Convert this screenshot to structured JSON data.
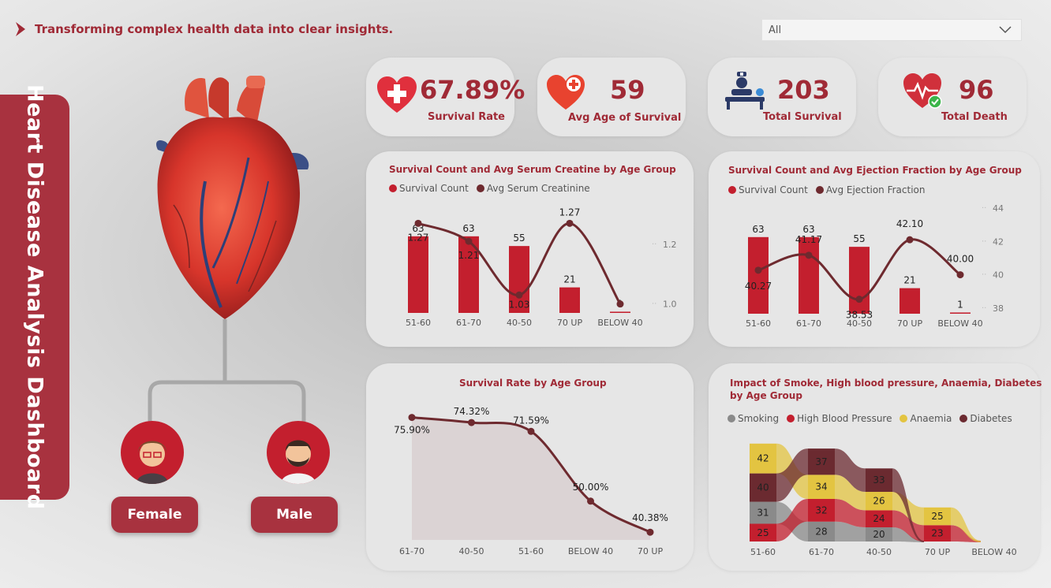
{
  "header": {
    "tagline": "Transforming complex health data into clear insights."
  },
  "filter": {
    "value": "All"
  },
  "sidebar": {
    "title": "Heart Disease Analysis Dashboard"
  },
  "gender": {
    "female": "Female",
    "male": "Male"
  },
  "kpis": [
    {
      "value": "67.89%",
      "label": "Survival Rate",
      "icon": "heart-plus-icon"
    },
    {
      "value": "59",
      "label": "Avg Age of Survival",
      "icon": "heart-medical-icon"
    },
    {
      "value": "203",
      "label": "Total Survival",
      "icon": "patient-bed-icon"
    },
    {
      "value": "96",
      "label": "Total Death",
      "icon": "heart-pulse-icon"
    }
  ],
  "colors": {
    "accent": "#a02a36",
    "bar": "#c31f2e",
    "line": "#6e2a2f",
    "smoking": "#8a8a8a",
    "hbp": "#c31f2e",
    "anaemia": "#e3c441",
    "diabetes": "#6b2a30"
  },
  "chart_data": [
    {
      "type": "bar",
      "title": "Survival Count and Avg Serum Creatine by Age Group",
      "categories": [
        "51-60",
        "61-70",
        "40-50",
        "70 UP",
        "BELOW 40"
      ],
      "series": [
        {
          "name": "Survival Count",
          "kind": "bar",
          "values": [
            63,
            63,
            55,
            21,
            1
          ]
        },
        {
          "name": "Avg Serum Creatinine",
          "kind": "line",
          "values": [
            1.27,
            1.21,
            1.03,
            1.27,
            1.0
          ]
        }
      ],
      "y2_ticks": [
        "1.2",
        "1.0"
      ]
    },
    {
      "type": "bar",
      "title": "Survival Count and Avg Ejection Fraction by Age Group",
      "categories": [
        "51-60",
        "61-70",
        "40-50",
        "70 UP",
        "BELOW 40"
      ],
      "series": [
        {
          "name": "Survival Count",
          "kind": "bar",
          "values": [
            63,
            63,
            55,
            21,
            1
          ]
        },
        {
          "name": "Avg Ejection Fraction",
          "kind": "line",
          "values": [
            40.27,
            41.17,
            38.53,
            42.1,
            40.0
          ]
        }
      ],
      "y2_ticks": [
        "44",
        "42",
        "40",
        "38"
      ]
    },
    {
      "type": "area",
      "title": "Survival Rate by Age Group",
      "categories": [
        "61-70",
        "40-50",
        "51-60",
        "BELOW 40",
        "70 UP"
      ],
      "values": [
        75.9,
        74.32,
        71.59,
        50.0,
        40.38
      ],
      "labels": [
        "75.90%",
        "74.32%",
        "71.59%",
        "50.00%",
        "40.38%"
      ]
    },
    {
      "type": "bar",
      "title": "Impact of Smoke, High blood pressure, Anaemia, Diabetes by Age Group",
      "title_line1": "Impact of Smoke, High blood pressure, Anaemia, Diabetes",
      "title_line2": "by Age Group",
      "categories": [
        "51-60",
        "61-70",
        "40-50",
        "70 UP",
        "BELOW 40"
      ],
      "series": [
        {
          "name": "Smoking",
          "values": [
            31,
            28,
            20,
            null,
            null
          ]
        },
        {
          "name": "High Blood Pressure",
          "values": [
            25,
            32,
            24,
            23,
            null
          ]
        },
        {
          "name": "Anaemia",
          "values": [
            42,
            34,
            26,
            25,
            null
          ]
        },
        {
          "name": "Diabetes",
          "values": [
            40,
            37,
            33,
            null,
            null
          ]
        }
      ]
    }
  ]
}
